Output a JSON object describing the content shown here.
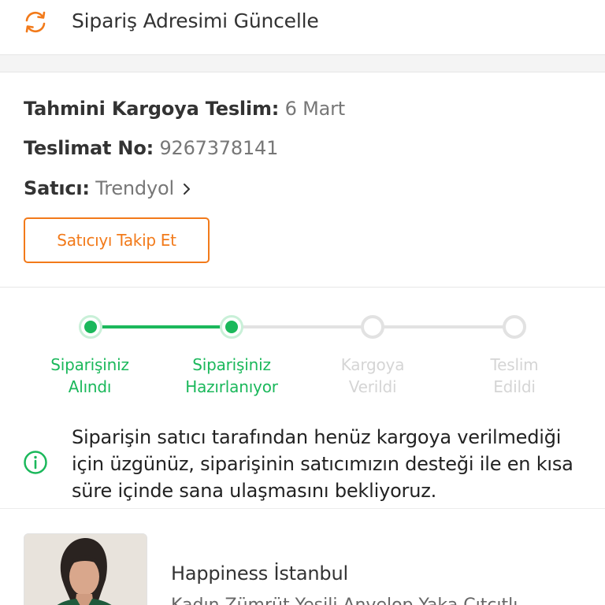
{
  "header": {
    "action_label": "Sipariş Adresimi Güncelle",
    "icon": "refresh-icon"
  },
  "shipment": {
    "estimated_label": "Tahmini Kargoya Teslim:",
    "estimated_value": "6 Mart",
    "delivery_no_label": "Teslimat No:",
    "delivery_no_value": "9267378141",
    "seller_label": "Satıcı:",
    "seller_value": "Trendyol",
    "follow_button": "Satıcıyı Takip Et"
  },
  "tracker": {
    "steps": [
      {
        "line1": "Siparişiniz",
        "line2": "Alındı",
        "status": "done"
      },
      {
        "line1": "Siparişiniz",
        "line2": "Hazırlanıyor",
        "status": "done"
      },
      {
        "line1": "Kargoya",
        "line2": "Verildi",
        "status": "todo"
      },
      {
        "line1": "Teslim",
        "line2": "Edildi",
        "status": "todo"
      }
    ]
  },
  "notice": {
    "icon": "info-icon",
    "message": "Siparişin satıcı tarafından henüz kargoya verilmediği için üzgünüz, siparişinin satıcımızın desteği ile en kısa süre içinde sana ulaşmasını bekliyoruz."
  },
  "product": {
    "brand": "Happiness İstanbul",
    "name": "Kadın Zümrüt Yeşili Anvelop Yaka Çıtçıtlı"
  },
  "colors": {
    "accent": "#f27a1a",
    "success": "#1bb85b",
    "inactive": "#e2e2e2"
  }
}
